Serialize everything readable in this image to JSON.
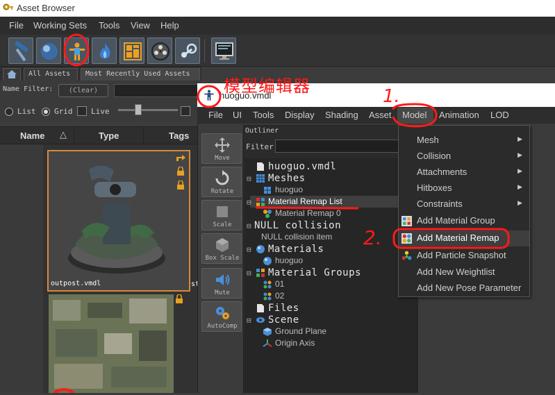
{
  "app": {
    "title": "Asset Browser",
    "menu": [
      "File",
      "Working Sets",
      "Tools",
      "View",
      "Help"
    ]
  },
  "toolbar": {
    "buttons": [
      "hammer-icon",
      "sphere-icon",
      "model-editor-icon",
      "fire-icon",
      "grid-icon",
      "film-reel-icon",
      "steam-icon",
      "monitor-icon"
    ]
  },
  "tabs": {
    "home": "home-icon",
    "all_assets": "All Assets",
    "recent": "Most Recently Used Assets"
  },
  "filter": {
    "label": "Name Filter:",
    "clear": "(Clear)",
    "value": ""
  },
  "view_options": {
    "list": "List",
    "grid": "Grid",
    "live": "Live"
  },
  "columns": [
    "Name",
    "Type",
    "Tags"
  ],
  "assets": {
    "tile1_caption": "outpost.vmdl",
    "tile2_partial": "st"
  },
  "model_editor": {
    "title": "huoguo.vmdl",
    "menu": [
      "File",
      "UI",
      "Tools",
      "Display",
      "Shading",
      "Asset",
      "Model",
      "Animation",
      "LOD"
    ],
    "side_tools": [
      "Move",
      "Rotate",
      "Scale",
      "Box Scale",
      "Mute",
      "AutoComp"
    ],
    "outliner_title": "Outliner",
    "filter_label": "Filter",
    "tree": [
      {
        "label": "huoguo.vmdl",
        "style": "big"
      },
      {
        "label": "Meshes",
        "style": "big"
      },
      {
        "label": "huoguo",
        "style": "small"
      },
      {
        "label": "Material Remap List",
        "style": "selected"
      },
      {
        "label": "Material Remap 0",
        "style": "small"
      },
      {
        "label": "NULL collision",
        "style": "big"
      },
      {
        "label": "NULL collision item",
        "style": "small"
      },
      {
        "label": "Materials",
        "style": "big"
      },
      {
        "label": "huoguo",
        "style": "small"
      },
      {
        "label": "Material Groups",
        "style": "big"
      },
      {
        "label": "01",
        "style": "small"
      },
      {
        "label": "02",
        "style": "small"
      },
      {
        "label": "Files",
        "style": "big"
      },
      {
        "label": "Scene",
        "style": "big"
      },
      {
        "label": "Ground Plane",
        "style": "small"
      },
      {
        "label": "Origin Axis",
        "style": "small"
      }
    ]
  },
  "model_menu": {
    "items": [
      {
        "label": "Mesh",
        "submenu": true
      },
      {
        "label": "Collision",
        "submenu": true
      },
      {
        "label": "Attachments",
        "submenu": true
      },
      {
        "label": "Hitboxes",
        "submenu": true
      },
      {
        "label": "Constraints",
        "submenu": true
      },
      {
        "label": "Add Material Group",
        "submenu": false
      },
      {
        "label": "Add Material Remap",
        "submenu": false
      },
      {
        "label": "Add Particle Snapshot",
        "submenu": false
      },
      {
        "label": "Add New Weightlist",
        "submenu": false
      },
      {
        "label": "Add New Pose Parameter",
        "submenu": false
      }
    ]
  },
  "annotations": {
    "model_editor_cn": "模型编辑器",
    "step1": "1.",
    "step2": "2.",
    "color": "#ff1a1a"
  }
}
